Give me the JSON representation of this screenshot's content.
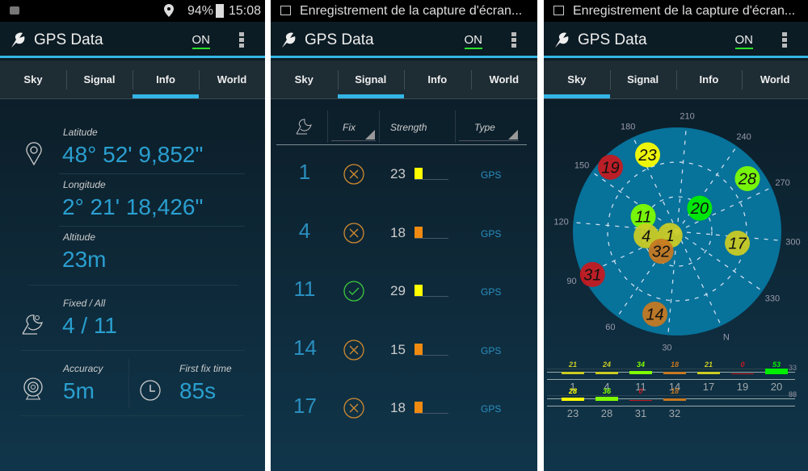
{
  "app": {
    "title": "GPS Data",
    "on_label": "ON",
    "tabs": [
      "Sky",
      "Signal",
      "Info",
      "World"
    ]
  },
  "status_p1": {
    "battery": "94%",
    "time": "15:08"
  },
  "notification": "Enregistrement de la capture d'écran...",
  "info": {
    "latitude_label": "Latitude",
    "latitude": "48° 52' 9,852\"",
    "longitude_label": "Longitude",
    "longitude": "2° 21' 18,426\"",
    "altitude_label": "Altitude",
    "altitude": "23m",
    "fixed_label": "Fixed / All",
    "fixed": "4 / 11",
    "accuracy_label": "Accuracy",
    "accuracy": "5m",
    "first_fix_label": "First fix time",
    "first_fix": "85s"
  },
  "signal": {
    "headers": {
      "fix": "Fix",
      "strength": "Strength",
      "type": "Type"
    },
    "rows": [
      {
        "prn": "1",
        "fixed": false,
        "strength": "23",
        "color": "#ffff00",
        "type": "GPS"
      },
      {
        "prn": "4",
        "fixed": false,
        "strength": "18",
        "color": "#f08a10",
        "type": "GPS"
      },
      {
        "prn": "11",
        "fixed": true,
        "strength": "29",
        "color": "#ffff00",
        "type": "GPS"
      },
      {
        "prn": "14",
        "fixed": false,
        "strength": "15",
        "color": "#f08a10",
        "type": "GPS"
      },
      {
        "prn": "17",
        "fixed": false,
        "strength": "18",
        "color": "#f08a10",
        "type": "GPS"
      }
    ]
  },
  "sky": {
    "azimuth_labels": [
      "N",
      "30",
      "60",
      "90",
      "120",
      "150",
      "180",
      "210",
      "240",
      "270",
      "300",
      "330"
    ],
    "satellites": [
      {
        "prn": "19",
        "azimuth": 159,
        "elevation": 10,
        "color": "#c8191e"
      },
      {
        "prn": "23",
        "azimuth": 184,
        "elevation": 19,
        "color": "#ffff00"
      },
      {
        "prn": "28",
        "azimuth": 258,
        "elevation": 14,
        "color": "#7fff00"
      },
      {
        "prn": "20",
        "azimuth": 249,
        "elevation": 62,
        "color": "#00ee00"
      },
      {
        "prn": "11",
        "azimuth": 139,
        "elevation": 58,
        "color": "#7fff00"
      },
      {
        "prn": "4",
        "azimuth": 107,
        "elevation": 63,
        "color": "#cccc22"
      },
      {
        "prn": "1",
        "azimuth": 86,
        "elevation": 83,
        "color": "#cccc22"
      },
      {
        "prn": "32",
        "azimuth": 64,
        "elevation": 68,
        "color": "#c87820"
      },
      {
        "prn": "17",
        "azimuth": 306,
        "elevation": 37,
        "color": "#cccc22"
      },
      {
        "prn": "31",
        "azimuth": 88,
        "elevation": 8,
        "color": "#c8191e"
      },
      {
        "prn": "14",
        "azimuth": 40,
        "elevation": 16,
        "color": "#c87820"
      }
    ]
  },
  "snr_bars": {
    "scale_labels": [
      "33",
      "66"
    ],
    "rows": [
      [
        {
          "prn": "1",
          "snr": "21",
          "color": "#cccc22"
        },
        {
          "prn": "4",
          "snr": "24",
          "color": "#cccc22"
        },
        {
          "prn": "11",
          "snr": "34",
          "color": "#7fff00"
        },
        {
          "prn": "14",
          "snr": "18",
          "color": "#c87820"
        },
        {
          "prn": "17",
          "snr": "21",
          "color": "#cccc22"
        },
        {
          "prn": "19",
          "snr": "0",
          "color": "#c8191e"
        },
        {
          "prn": "20",
          "snr": "53",
          "color": "#00ee00"
        }
      ],
      [
        {
          "prn": "23",
          "snr": "28",
          "color": "#ffff00"
        },
        {
          "prn": "28",
          "snr": "36",
          "color": "#7fff00"
        },
        {
          "prn": "31",
          "snr": "0",
          "color": "#c8191e"
        },
        {
          "prn": "32",
          "snr": "18",
          "color": "#c87820"
        }
      ]
    ]
  }
}
